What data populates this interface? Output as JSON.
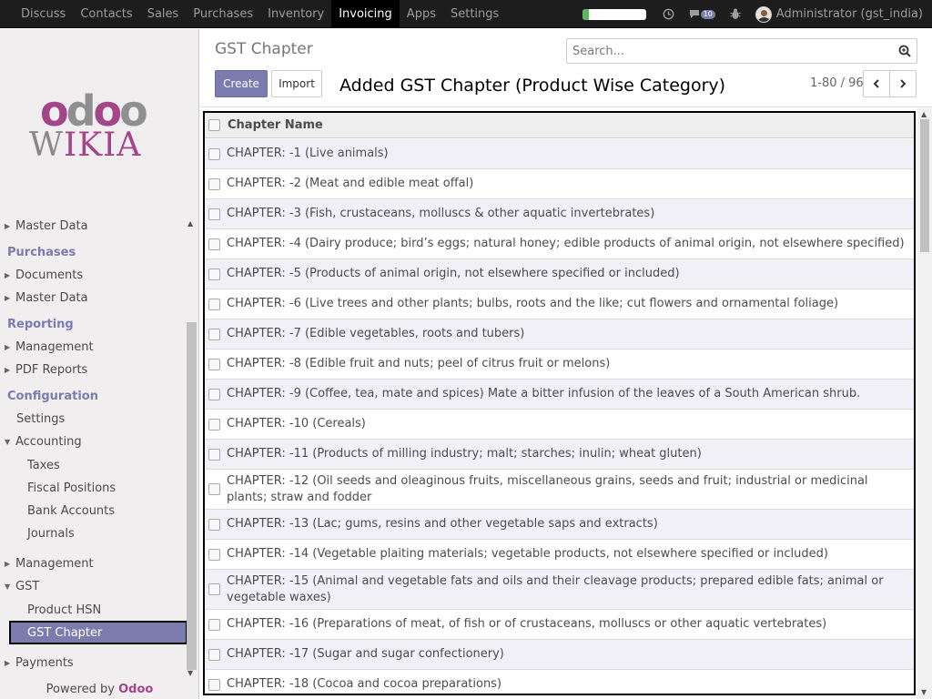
{
  "navbar": {
    "apps": [
      "Discuss",
      "Contacts",
      "Sales",
      "Purchases",
      "Inventory",
      "Invoicing",
      "Apps",
      "Settings"
    ],
    "active_app": "Invoicing",
    "progress_fraction": 0.1,
    "message_count": "10",
    "user": "Administrator (gst_india)"
  },
  "sidebar": {
    "logo": {
      "line1": "odoo",
      "line2": "WIKIA"
    },
    "master_data_top": "Master Data",
    "purchases_header": "Purchases",
    "documents": "Documents",
    "master_data_purchases": "Master Data",
    "reporting_header": "Reporting",
    "management_reporting": "Management",
    "pdf_reports": "PDF Reports",
    "configuration_header": "Configuration",
    "settings": "Settings",
    "accounting": "Accounting",
    "taxes": "Taxes",
    "fiscal_positions": "Fiscal Positions",
    "bank_accounts": "Bank Accounts",
    "journals": "Journals",
    "management_config": "Management",
    "gst": "GST",
    "product_hsn": "Product HSN",
    "gst_chapter": "GST Chapter",
    "payments": "Payments",
    "powered_by": "Powered by",
    "powered_brand": "Odoo"
  },
  "control_panel": {
    "breadcrumb": "GST Chapter",
    "search_placeholder": "Search...",
    "create_label": "Create",
    "import_label": "Import",
    "annotation": "Added GST Chapter (Product Wise Category)",
    "pager": "1-80 / 96"
  },
  "list": {
    "column_header": "Chapter Name",
    "rows": [
      "CHAPTER: -1 (Live animals)",
      "CHAPTER: -2 (Meat and edible meat offal)",
      "CHAPTER: -3 (Fish, crustaceans, molluscs & other aquatic invertebrates)",
      "CHAPTER: -4 (Dairy produce; bird’s eggs; natural honey; edible products of animal origin, not elsewhere specified)",
      "CHAPTER: -5 (Products of animal origin, not elsewhere specified or included)",
      "CHAPTER: -6 (Live trees and other plants; bulbs, roots and the like; cut flowers and ornamental foliage)",
      "CHAPTER: -7 (Edible vegetables, roots and tubers)",
      "CHAPTER: -8 (Edible fruit and nuts; peel of citrus fruit or melons)",
      "CHAPTER: -9 (Coffee, tea, mate and spices) Mate a bitter infusion of the leaves of a South American shrub.",
      "CHAPTER: -10 (Cereals)",
      "CHAPTER: -11 (Products of milling industry; malt; starches; inulin; wheat gluten)",
      "CHAPTER: -12 (Oil seeds and oleaginous fruits, miscellaneous grains, seeds and fruit; industrial or medicinal plants; straw and fodder",
      "CHAPTER: -13 (Lac; gums, resins and other vegetable saps and extracts)",
      "CHAPTER: -14 (Vegetable plaiting materials; vegetable products, not elsewhere specified or included)",
      "CHAPTER: -15 (Animal and vegetable fats and oils and their cleavage products; prepared edible fats; animal or vegetable waxes)",
      "CHAPTER: -16 (Preparations of meat, of fish or of crustaceans, molluscs or other aquatic vertebrates)",
      "CHAPTER: -17 (Sugar and sugar confectionery)",
      "CHAPTER: -18 (Cocoa and cocoa preparations)"
    ]
  },
  "colors": {
    "accent": "#7c7bad",
    "brand": "#a24689",
    "navbar_bg": "#1d1d1d"
  }
}
